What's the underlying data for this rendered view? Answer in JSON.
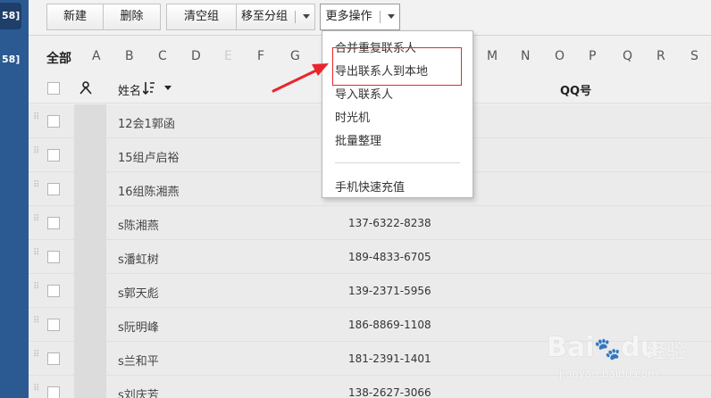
{
  "sidebar": {
    "badge1": "58]",
    "badge2": "58]"
  },
  "toolbar": {
    "new_label": "新建",
    "delete_label": "删除",
    "clear_group_label": "清空组",
    "move_group_label": "移至分组",
    "more_ops_label": "更多操作"
  },
  "alphabet": {
    "all_label": "全部",
    "letters": [
      "A",
      "B",
      "C",
      "D",
      "E",
      "F",
      "G",
      "M",
      "N",
      "O",
      "P",
      "Q",
      "R",
      "S"
    ]
  },
  "header": {
    "name_label": "姓名",
    "qq_label": "QQ号"
  },
  "contacts": [
    {
      "name": "12会1郭函",
      "phone": ""
    },
    {
      "name": "15组卢启裕",
      "phone": ""
    },
    {
      "name": "16组陈湘燕",
      "phone": ""
    },
    {
      "name": "s陈湘燕",
      "phone": "137-6322-8238"
    },
    {
      "name": "s潘虹树",
      "phone": "189-4833-6705"
    },
    {
      "name": "s郭天彪",
      "phone": "139-2371-5956"
    },
    {
      "name": "s阮明峰",
      "phone": "186-8869-1108"
    },
    {
      "name": "s兰和平",
      "phone": "181-2391-1401"
    },
    {
      "name": "s刘庆芳",
      "phone": "138-2627-3066"
    }
  ],
  "more_menu": {
    "items": [
      "合并重复联系人",
      "导出联系人到本地",
      "导入联系人",
      "时光机",
      "批量整理"
    ],
    "recharge": "手机快速充值"
  },
  "watermark": {
    "logo": "Bai",
    "logo2": "du",
    "text": "经验",
    "url": "jingyan.baidu.com"
  },
  "colors": {
    "sidebar": "#2b5a93",
    "highlight": "#e8262c"
  }
}
